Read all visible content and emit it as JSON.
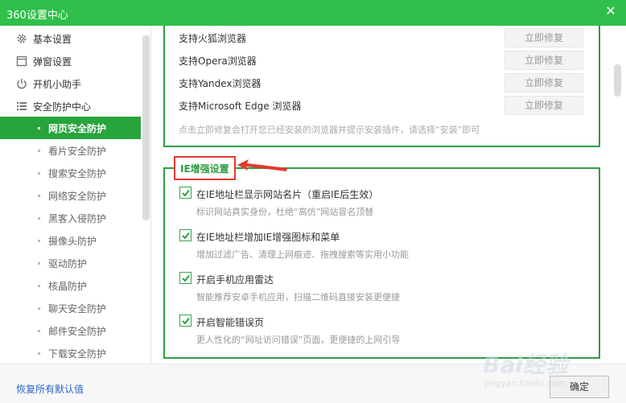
{
  "window": {
    "title": "360设置中心"
  },
  "sidebar": {
    "top_items": [
      {
        "label": "基本设置",
        "icon": "gear-icon"
      },
      {
        "label": "弹窗设置",
        "icon": "popup-window-icon"
      },
      {
        "label": "开机小助手",
        "icon": "power-icon"
      },
      {
        "label": "安全防护中心",
        "icon": "list-icon"
      }
    ],
    "sub_items": [
      {
        "label": "网页安全防护",
        "active": true
      },
      {
        "label": "看片安全防护",
        "active": false
      },
      {
        "label": "搜索安全防护",
        "active": false
      },
      {
        "label": "网络安全防护",
        "active": false
      },
      {
        "label": "黑客入侵防护",
        "active": false
      },
      {
        "label": "摄像头防护",
        "active": false
      },
      {
        "label": "驱动防护",
        "active": false
      },
      {
        "label": "核晶防护",
        "active": false
      },
      {
        "label": "聊天安全防护",
        "active": false
      },
      {
        "label": "邮件安全防护",
        "active": false
      },
      {
        "label": "下载安全防护",
        "active": false
      }
    ]
  },
  "browser_support": {
    "rows": [
      {
        "label": "支持火狐浏览器",
        "button": "立即修复"
      },
      {
        "label": "支持Opera浏览器",
        "button": "立即修复"
      },
      {
        "label": "支持Yandex浏览器",
        "button": "立即修复"
      },
      {
        "label": "支持Microsoft Edge 浏览器",
        "button": "立即修复"
      }
    ],
    "hint": "点击立即修复会打开您已经安装的浏览器并提示安装插件，请选择“安装”即可"
  },
  "ie_section": {
    "title": "IE增强设置",
    "options": [
      {
        "label": "在IE地址栏显示网站名片（重启IE后生效）",
        "desc": "标识网站真实身份，杜绝“高仿”网站冒名顶替",
        "checked": true
      },
      {
        "label": "在IE地址栏增加IE增强图标和菜单",
        "desc": "增加过滤广告、清理上网痕迹、拖拽搜索等实用小功能",
        "checked": true
      },
      {
        "label": "开启手机应用雷达",
        "desc": "智能推荐安卓手机应用，扫描二维码直接安装更便捷",
        "checked": true
      },
      {
        "label": "开启智能错误页",
        "desc": "更人性化的“网址访问错误”页面，更便捷的上网引导",
        "checked": true
      }
    ]
  },
  "footer": {
    "reset_label": "恢复所有默认值",
    "ok_label": "确定"
  },
  "watermark": {
    "text1": "Bai经验",
    "text2": "jingyan.baidu.com"
  },
  "colors": {
    "brand_green": "#2fbf4a",
    "active_green": "#28a43c",
    "border_green": "#2e9d44",
    "highlight_red": "#e23b2e",
    "link_blue": "#2a66c9"
  }
}
